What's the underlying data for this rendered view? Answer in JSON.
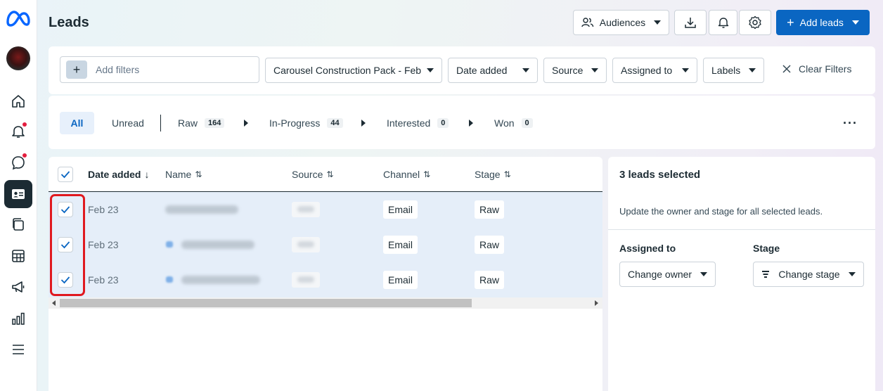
{
  "app": {
    "logo_icon": "meta-logo-icon",
    "page_title": "Leads"
  },
  "rail": {
    "items": [
      {
        "icon": "home-icon"
      },
      {
        "icon": "bell-icon",
        "badge": true
      },
      {
        "icon": "chat-bubble-icon",
        "badge": true
      },
      {
        "icon": "contact-card-icon",
        "active": true
      },
      {
        "icon": "pages-icon"
      },
      {
        "icon": "table-icon"
      },
      {
        "icon": "megaphone-icon"
      },
      {
        "icon": "bar-chart-icon"
      },
      {
        "icon": "menu-icon"
      }
    ]
  },
  "toolbar": {
    "audiences_label": "Audiences",
    "add_leads_label": "Add leads",
    "add_leads_color": "#0a66c2"
  },
  "filters": {
    "add_filters_placeholder": "Add filters",
    "form_selected": "Carousel Construction Pack - Feb",
    "date_added": "Date added",
    "source": "Source",
    "assigned_to": "Assigned to",
    "labels": "Labels",
    "clear": "Clear Filters"
  },
  "tabs": [
    {
      "label": "All",
      "active": true
    },
    {
      "label": "Unread"
    },
    {
      "label": "Raw",
      "count": "164"
    },
    {
      "label": "In-Progress",
      "count": "44"
    },
    {
      "label": "Interested",
      "count": "0"
    },
    {
      "label": "Won",
      "count": "0"
    }
  ],
  "table": {
    "headers": {
      "date_added": "Date added",
      "name": "Name",
      "source": "Source",
      "channel": "Channel",
      "stage": "Stage"
    },
    "rows": [
      {
        "date": "Feb 23",
        "channel": "Email",
        "stage": "Raw"
      },
      {
        "date": "Feb 23",
        "channel": "Email",
        "stage": "Raw"
      },
      {
        "date": "Feb 23",
        "channel": "Email",
        "stage": "Raw"
      }
    ]
  },
  "side_panel": {
    "title": "3 leads selected",
    "description": "Update the owner and stage for all selected leads.",
    "assigned_label": "Assigned to",
    "owner_button": "Change owner",
    "stage_label": "Stage",
    "stage_button": "Change stage"
  },
  "colors": {
    "selected_row": "#e5eef9",
    "highlight": "#e0191f",
    "accent": "#0a66c2"
  }
}
